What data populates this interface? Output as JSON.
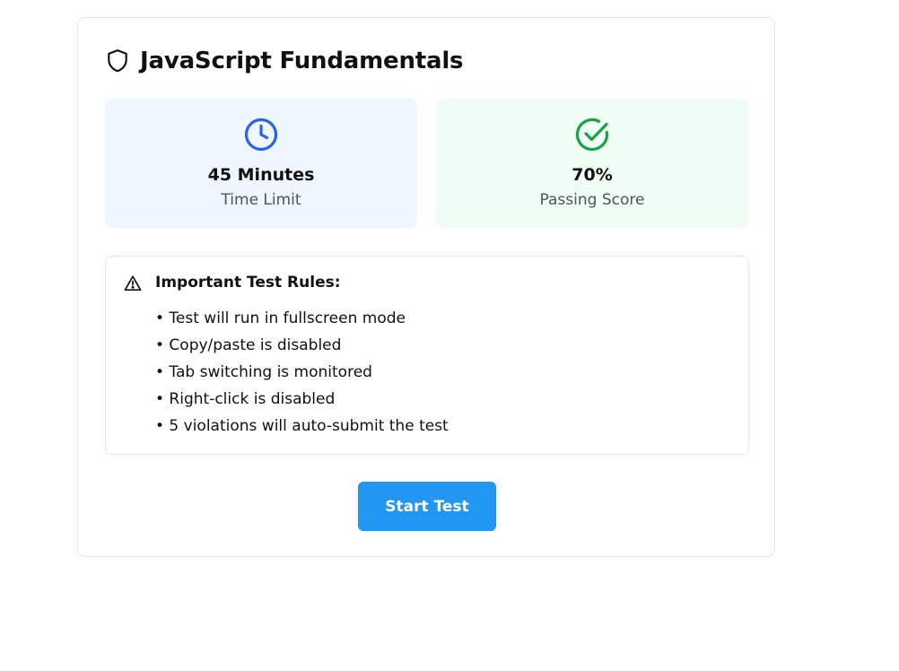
{
  "test": {
    "title": "JavaScript Fundamentals",
    "title_icon": "shield-icon"
  },
  "stats": [
    {
      "value": "45 Minutes",
      "label": "Time Limit",
      "icon": "clock-icon",
      "color": "#2563eb",
      "background": "#eff6ff"
    },
    {
      "value": "70%",
      "label": "Passing Score",
      "icon": "check-circle-icon",
      "color": "#16a34a",
      "background": "#f0fdf4"
    }
  ],
  "rules": {
    "icon": "warning-triangle-icon",
    "heading": "Important Test Rules:",
    "items": [
      "• Test will run in fullscreen mode",
      "• Copy/paste is disabled",
      "• Tab switching is monitored",
      "• Right-click is disabled",
      "• 5 violations will auto-submit the test"
    ]
  },
  "actions": {
    "start_label": "Start Test",
    "start_color": "#2196f3"
  }
}
